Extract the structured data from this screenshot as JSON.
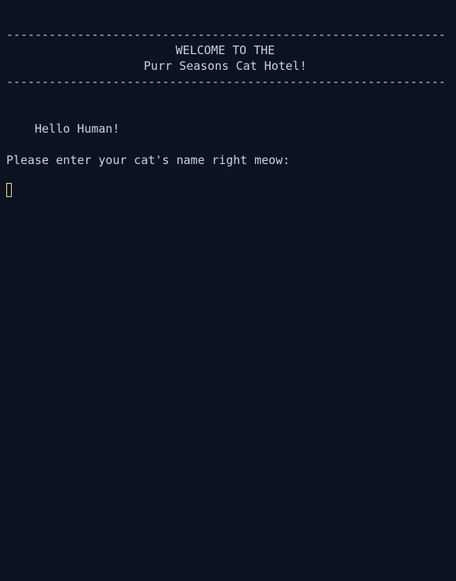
{
  "terminal": {
    "divider_top": "--------------------------------------------------------------------------------",
    "welcome_line": "WELCOME TO THE",
    "hotel_name": "Purr Seasons Cat Hotel!",
    "divider_bottom": "--------------------------------------------------------------------------------",
    "greeting": "    Hello Human!",
    "prompt": "Please enter your cat's name right meow:",
    "input_value": ""
  },
  "colors": {
    "background": "#0b1220",
    "text": "#c8d2e0",
    "cursor": "#e6e08a"
  }
}
